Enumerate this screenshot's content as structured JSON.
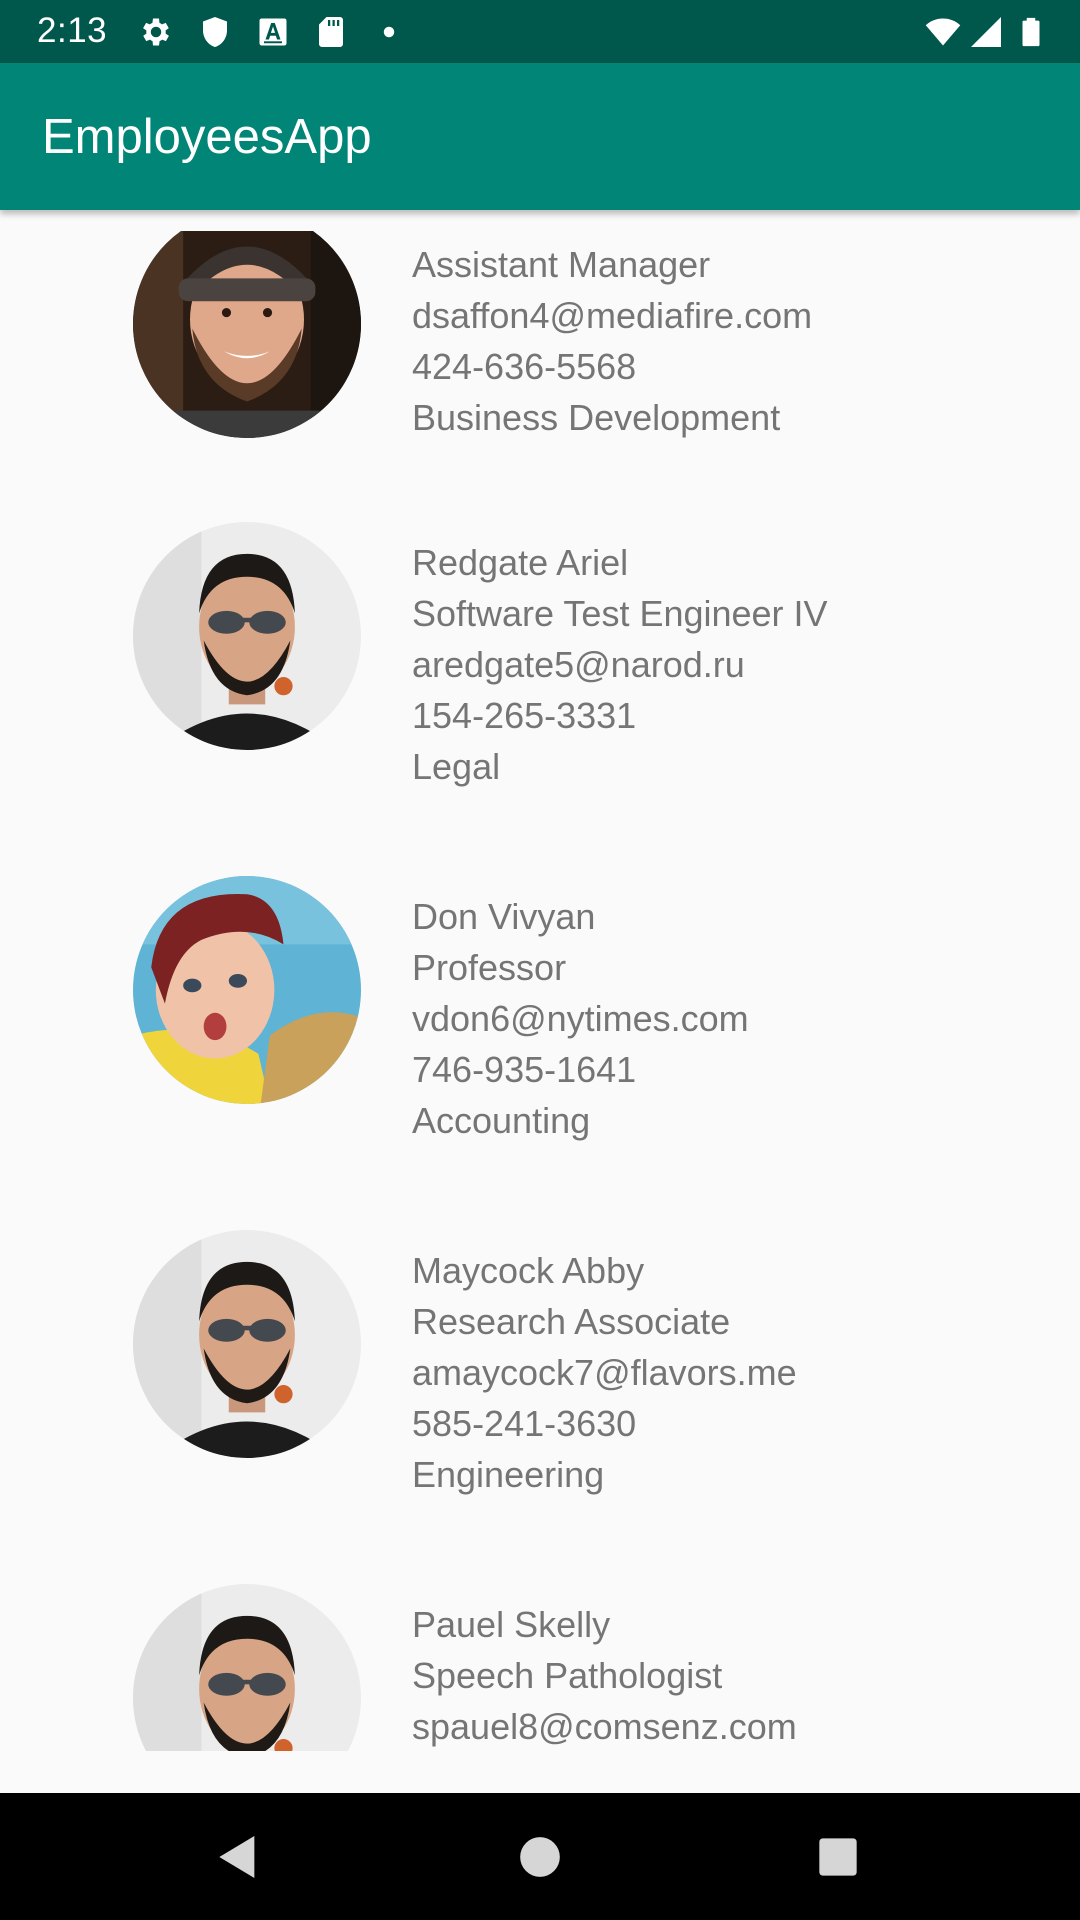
{
  "status_bar": {
    "time": "2:13",
    "icons": [
      "gear-icon",
      "shield-icon",
      "font-a-icon",
      "sd-card-icon",
      "dot-icon",
      "wifi-icon",
      "signal-icon",
      "battery-icon"
    ]
  },
  "app_bar": {
    "title": "EmployeesApp"
  },
  "employees": [
    {
      "avatar": "bearded-man-cap-photo",
      "lines": [
        "Assistant Manager",
        "dsaffon4@mediafire.com",
        "424-636-5568",
        "Business Development"
      ]
    },
    {
      "avatar": "man-sunglasses-photo",
      "lines": [
        "Redgate Ariel",
        "Software Test Engineer IV",
        "aredgate5@narod.ru",
        "154-265-3331",
        "Legal"
      ]
    },
    {
      "avatar": "woman-red-hair-photo",
      "lines": [
        "Don Vivyan",
        "Professor",
        "vdon6@nytimes.com",
        "746-935-1641",
        "Accounting"
      ]
    },
    {
      "avatar": "man-sunglasses-photo",
      "lines": [
        "Maycock Abby",
        "Research Associate",
        "amaycock7@flavors.me",
        "585-241-3630",
        "Engineering"
      ]
    },
    {
      "avatar": "man-sunglasses-photo",
      "lines": [
        "Pauel Skelly",
        "Speech Pathologist",
        "spauel8@comsenz.com"
      ]
    }
  ],
  "nav_bar": {
    "buttons": [
      "back-icon",
      "home-icon",
      "recents-icon"
    ]
  },
  "colors": {
    "status_bar": "#00574b",
    "app_bar": "#008577",
    "background": "#fafafa",
    "text": "#757575"
  }
}
